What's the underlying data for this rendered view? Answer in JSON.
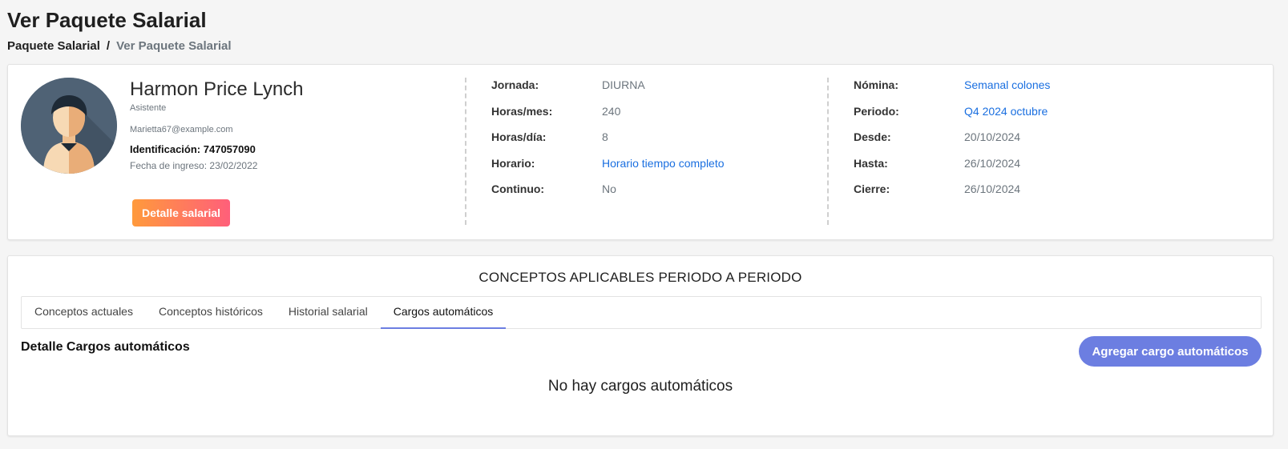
{
  "page": {
    "title": "Ver Paquete Salarial",
    "breadcrumb": {
      "root": "Paquete Salarial",
      "separator": "/",
      "current": "Ver Paquete Salarial"
    }
  },
  "employee": {
    "name": "Harmon Price Lynch",
    "role": "Asistente",
    "email": "Marietta67@example.com",
    "id_label": "Identificación:",
    "id_value": "747057090",
    "start_date": "Fecha de ingreso: 23/02/2022",
    "salary_button": "Detalle salarial",
    "avatar_icon": "user-avatar-icon"
  },
  "schedule": [
    {
      "label": "Jornada:",
      "value": "DIURNA",
      "link": false
    },
    {
      "label": "Horas/mes:",
      "value": "240",
      "link": false
    },
    {
      "label": "Horas/día:",
      "value": "8",
      "link": false
    },
    {
      "label": "Horario:",
      "value": "Horario tiempo completo",
      "link": true
    },
    {
      "label": "Continuo:",
      "value": "No",
      "link": false
    }
  ],
  "payroll": [
    {
      "label": "Nómina:",
      "value": "Semanal colones",
      "link": true
    },
    {
      "label": "Periodo:",
      "value": "Q4 2024 octubre",
      "link": true
    },
    {
      "label": "Desde:",
      "value": "20/10/2024",
      "link": false
    },
    {
      "label": "Hasta:",
      "value": "26/10/2024",
      "link": false
    },
    {
      "label": "Cierre:",
      "value": "26/10/2024",
      "link": false
    }
  ],
  "concepts": {
    "title": "CONCEPTOS APLICABLES PERIODO A PERIODO",
    "tabs": [
      {
        "label": "Conceptos actuales",
        "active": false
      },
      {
        "label": "Conceptos históricos",
        "active": false
      },
      {
        "label": "Historial salarial",
        "active": false
      },
      {
        "label": "Cargos automáticos",
        "active": true
      }
    ],
    "detail_title": "Detalle Cargos automáticos",
    "add_button": "Agregar cargo automáticos",
    "empty_message": "No hay cargos automáticos"
  },
  "colors": {
    "accent": "#6c7ee1",
    "link": "#1a6fe0",
    "gradient_start": "#ff9a3c",
    "gradient_end": "#ff5f7a"
  }
}
